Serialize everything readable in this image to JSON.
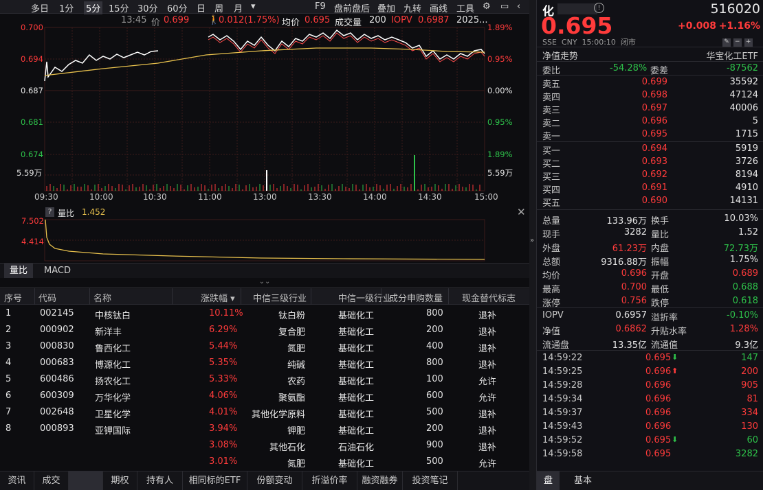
{
  "toolbar": {
    "items": [
      "多日",
      "1分",
      "5分",
      "15分",
      "30分",
      "60分",
      "日",
      "周",
      "月",
      "▾",
      "F9",
      "盘前盘后",
      "叠加",
      "九转",
      "画线",
      "工具"
    ],
    "active": "5分"
  },
  "info": {
    "time": "13:45",
    "price_label": "价",
    "price": "0.699",
    "change": "0.012(1.75%)",
    "avg_label": "均价",
    "avg": "0.695",
    "vol_label": "成交量",
    "vol": "200",
    "iopv_label": "IOPV",
    "iopv": "0.6987",
    "date": "2025..."
  },
  "chart": {
    "y_left": [
      "0.700",
      "0.694",
      "0.687",
      "0.681",
      "0.674"
    ],
    "y_right": [
      "1.89%",
      "0.95%",
      "0.00%",
      "0.95%",
      "1.89%"
    ],
    "vol_left": "5.59万",
    "vol_right": "5.59万",
    "x_labels": [
      "09:30",
      "10:00",
      "10:30",
      "11:00",
      "13:00",
      "13:30",
      "14:00",
      "14:30",
      "15:00"
    ],
    "colors": {
      "price": "#ffffff",
      "avg": "#e8c14d",
      "iopv": "#ff4d4d",
      "up": "#ff3b3b",
      "down": "#2ec24a",
      "grid": "#3a1a1a"
    }
  },
  "indicator": {
    "q_icon": "?",
    "name": "量比",
    "value": "1.452",
    "y": [
      "7.502",
      "4.414"
    ]
  },
  "ind_tabs": [
    "量比",
    "MACD"
  ],
  "table": {
    "headers": [
      "序号",
      "代码",
      "名称",
      "涨跌幅 ▾",
      "中信三级行业",
      "中信一级行业",
      "成分申购数量",
      "现金替代标志"
    ],
    "rows": [
      [
        "1",
        "002145",
        "中核钛白",
        "10.11%",
        "钛白粉",
        "基础化工",
        "800",
        "退补"
      ],
      [
        "2",
        "000902",
        "新洋丰",
        "6.29%",
        "复合肥",
        "基础化工",
        "200",
        "退补"
      ],
      [
        "3",
        "000830",
        "鲁西化工",
        "5.44%",
        "氮肥",
        "基础化工",
        "400",
        "退补"
      ],
      [
        "4",
        "000683",
        "博源化工",
        "5.35%",
        "纯碱",
        "基础化工",
        "800",
        "退补"
      ],
      [
        "5",
        "600486",
        "扬农化工",
        "5.33%",
        "农药",
        "基础化工",
        "100",
        "允许"
      ],
      [
        "6",
        "600309",
        "万华化学",
        "4.06%",
        "聚氨酯",
        "基础化工",
        "600",
        "允许"
      ],
      [
        "7",
        "002648",
        "卫星化学",
        "4.01%",
        "其他化学原料",
        "基础化工",
        "500",
        "退补"
      ],
      [
        "8",
        "000893",
        "亚钾国际",
        "3.94%",
        "钾肥",
        "基础化工",
        "200",
        "退补"
      ],
      [
        "",
        "",
        "",
        "3.08%",
        "其他石化",
        "石油石化",
        "900",
        "退补"
      ],
      [
        "",
        "",
        "",
        "3.01%",
        "氮肥",
        "基础化工",
        "500",
        "允许"
      ]
    ]
  },
  "bottom_tabs": [
    "资讯",
    "成交",
    "",
    "期权",
    "持有人",
    "相同标的ETF",
    "份额变动",
    "折溢价率",
    "融资融券",
    "投资笔记"
  ],
  "quote": {
    "name": "化",
    "code": "516020",
    "price": "0.695",
    "change": "+0.008",
    "pct": "+1.16%",
    "meta": "SSE  CNY  15:00:10  闭市",
    "nav_trend": "净值走势",
    "fund_name": "华宝化工ETF",
    "webi": [
      "委比",
      "-54.28%",
      "委差",
      "-87562"
    ],
    "asks": [
      [
        "卖五",
        "0.699",
        "35592"
      ],
      [
        "卖四",
        "0.698",
        "47124"
      ],
      [
        "卖三",
        "0.697",
        "40006"
      ],
      [
        "卖二",
        "0.696",
        "5"
      ],
      [
        "卖一",
        "0.695",
        "1715"
      ]
    ],
    "bids": [
      [
        "买一",
        "0.694",
        "5919"
      ],
      [
        "买二",
        "0.693",
        "3726"
      ],
      [
        "买三",
        "0.692",
        "8194"
      ],
      [
        "买四",
        "0.691",
        "4910"
      ],
      [
        "买五",
        "0.690",
        "14131"
      ]
    ],
    "stats": [
      [
        "总量",
        "133.96万",
        "换手",
        "10.03%"
      ],
      [
        "现手",
        "3282",
        "量比",
        "1.52"
      ],
      [
        "外盘",
        "61.23万",
        "内盘",
        "72.73万"
      ],
      [
        "总额",
        "9316.88万",
        "振幅",
        "1.75%"
      ],
      [
        "均价",
        "0.696",
        "开盘",
        "0.689"
      ],
      [
        "最高",
        "0.700",
        "最低",
        "0.688"
      ],
      [
        "涨停",
        "0.756",
        "跌停",
        "0.618"
      ]
    ],
    "etf": [
      [
        "IOPV",
        "0.6957",
        "溢折率",
        "-0.10%"
      ],
      [
        "净值",
        "0.6862",
        "升贴水率",
        "1.28%"
      ],
      [
        "流通盘",
        "13.35亿",
        "流通值",
        "9.3亿"
      ]
    ],
    "ticks": [
      [
        "14:59:22",
        "0.695",
        "down",
        "147"
      ],
      [
        "14:59:25",
        "0.696",
        "up",
        "200"
      ],
      [
        "14:59:28",
        "0.696",
        "",
        "905"
      ],
      [
        "14:59:34",
        "0.696",
        "",
        "81"
      ],
      [
        "14:59:37",
        "0.696",
        "",
        "334"
      ],
      [
        "14:59:43",
        "0.696",
        "",
        "130"
      ],
      [
        "14:59:52",
        "0.695",
        "down",
        "60"
      ],
      [
        "14:59:58",
        "0.695",
        "",
        "3282"
      ]
    ],
    "tabs": [
      "盘",
      "基本"
    ]
  }
}
